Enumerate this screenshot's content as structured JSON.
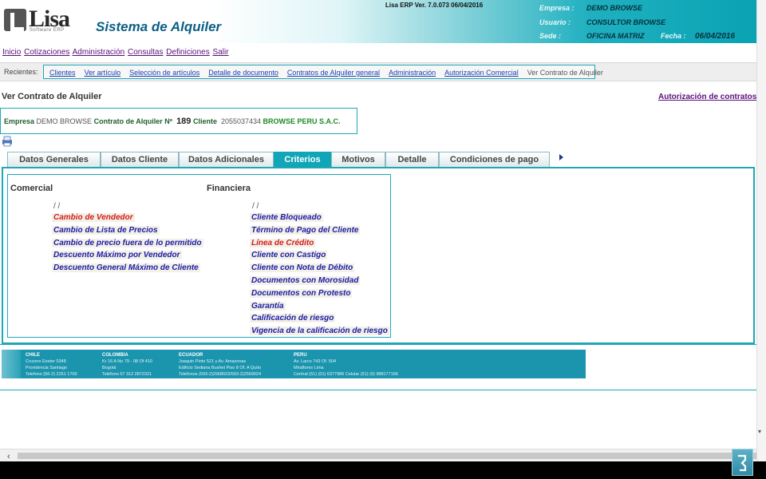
{
  "header": {
    "logo_text": "Lisa",
    "logo_subtext": "Software ERP",
    "app_title": "Sistema de Alquiler",
    "version": "Lisa ERP Ver. 7.0.073 06/04/2016",
    "empresa_label": "Empresa :",
    "empresa_value": "DEMO BROWSE",
    "usuario_label": "Usuario :",
    "usuario_value": "CONSULTOR BROWSE",
    "sede_label": "Sede :",
    "sede_value": "OFICINA MATRIZ",
    "fecha_label": "Fecha :",
    "fecha_value": "06/04/2016"
  },
  "menu": [
    "Inicio",
    "Cotizaciones",
    "Administración",
    "Consultas",
    "Definiciones",
    "Salir"
  ],
  "recents": {
    "label": "Recientes:",
    "links": [
      "Clientes",
      "Ver artículo",
      "Selección de artículos",
      "Detalle de documento",
      "Contratos de Alquiler general",
      "Administración",
      "Autorización Comercial"
    ],
    "current": "Ver Contrato de Alquiler"
  },
  "page": {
    "title": "Ver Contrato de Alquiler",
    "auth_link": "Autorización de contratos"
  },
  "info": {
    "empresa_label": "Empresa",
    "empresa_value": "DEMO BROWSE",
    "contrato_label": "Contrato de Alquiler Nº",
    "contrato_value": "189",
    "cliente_label": "Cliente",
    "cliente_ruc": "2055037434",
    "cliente_name": "BROWSE PERU S.A.C."
  },
  "tabs": [
    "Datos Generales",
    "Datos Cliente",
    "Datos Adicionales",
    "Criterios",
    "Motivos",
    "Detalle",
    "Condiciones de pago"
  ],
  "active_tab": "Criterios",
  "criteria": {
    "comercial": {
      "title": "Comercial",
      "date": "/ /",
      "items": [
        {
          "label": "Cambio de Vendedor",
          "status": "red"
        },
        {
          "label": "Cambio de Lista de Precios",
          "status": "blue"
        },
        {
          "label": "Cambio de precio fuera de lo permitido",
          "status": "blue"
        },
        {
          "label": "Descuento Máximo por Vendedor",
          "status": "blue"
        },
        {
          "label": "Descuento General Máximo de Cliente",
          "status": "blue"
        }
      ]
    },
    "financiera": {
      "title": "Financiera",
      "date": "/ /",
      "items": [
        {
          "label": "Cliente Bloqueado",
          "status": "blue"
        },
        {
          "label": "Término de Pago del Cliente",
          "status": "blue"
        },
        {
          "label": "Línea de Crédito",
          "status": "red"
        },
        {
          "label": "Cliente con Castigo",
          "status": "blue"
        },
        {
          "label": "Cliente con Nota de Débito",
          "status": "blue"
        },
        {
          "label": "Documentos con Morosidad",
          "status": "blue"
        },
        {
          "label": "Documentos con Protesto",
          "status": "blue"
        },
        {
          "label": "Garantía",
          "status": "blue"
        },
        {
          "label": "Calificación de riesgo",
          "status": "blue"
        },
        {
          "label": "Vigencia de la calificación de riesgo",
          "status": "blue"
        }
      ]
    }
  },
  "footer": {
    "offices": [
      {
        "country": "CHILE",
        "lines": [
          "Cruzero Exeter 0348",
          "Providencia  Santiago",
          "Telefono (56-2) 2251 1700"
        ]
      },
      {
        "country": "COLOMBIA",
        "lines": [
          "Kr 16 A No 79 - 08 Of 410",
          "Bogotá",
          "Teléfono 57 312 2872321"
        ]
      },
      {
        "country": "ECUADOR",
        "lines": [
          "Joaquin Pinto 521 y Av. Amazonas",
          "Edificio Sediana Bushet  Piso 8  Of. A Quito",
          "Telefonos (593-2)2568023/593-2)2569024"
        ]
      },
      {
        "country": "PERU",
        "lines": [
          "Av. Larco 743  Of. 504",
          "Miraflores Lima",
          "Central (51) (01) 6377986 Celular (51) (9) 988177166"
        ]
      }
    ]
  },
  "colors": {
    "accent": "#1fa7b6",
    "active_tab": "#10a5b7",
    "criteria_blue": "#1a1aa6",
    "criteria_red": "#d41b1b",
    "link_purple": "#5a0f7a"
  }
}
